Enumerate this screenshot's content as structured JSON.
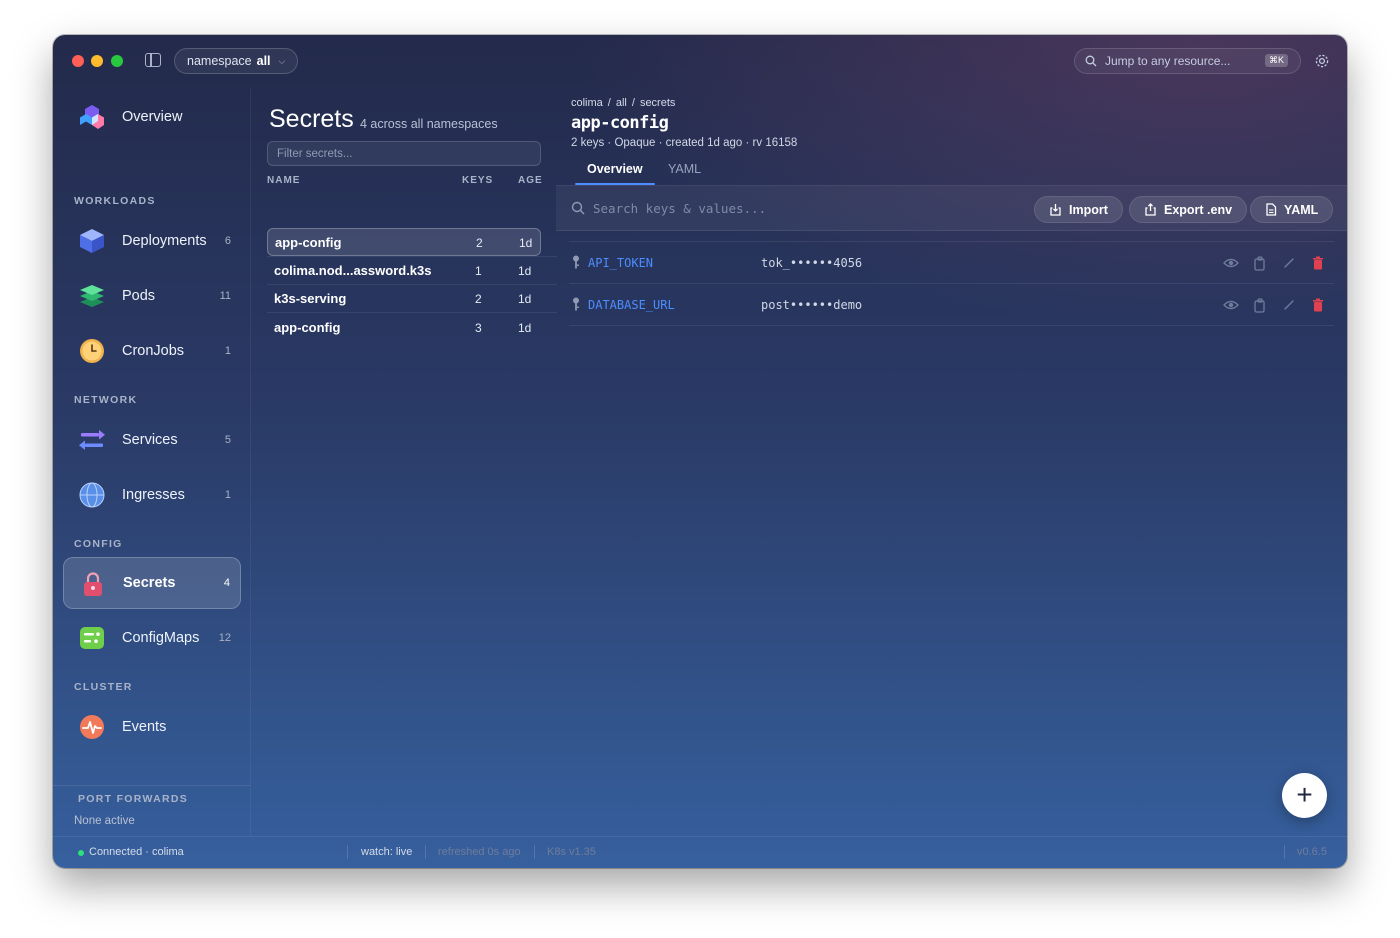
{
  "titlebar": {
    "namespace_prefix": "namespace",
    "namespace_value": "all",
    "jump_placeholder": "Jump to any resource...",
    "jump_shortcut": "⌘K"
  },
  "sidebar": {
    "overview": "Overview",
    "sections": {
      "workloads": "WORKLOADS",
      "network": "NETWORK",
      "config": "CONFIG",
      "cluster": "CLUSTER"
    },
    "items": {
      "deployments": {
        "label": "Deployments",
        "count": "6"
      },
      "pods": {
        "label": "Pods",
        "count": "11"
      },
      "cronjobs": {
        "label": "CronJobs",
        "count": "1"
      },
      "services": {
        "label": "Services",
        "count": "5"
      },
      "ingresses": {
        "label": "Ingresses",
        "count": "1"
      },
      "secrets": {
        "label": "Secrets",
        "count": "4"
      },
      "configmaps": {
        "label": "ConfigMaps",
        "count": "12"
      },
      "events": {
        "label": "Events"
      }
    },
    "port_forwards_title": "PORT FORWARDS",
    "port_forwards_value": "None active"
  },
  "list": {
    "title": "Secrets",
    "subtitle": "4 across all namespaces",
    "filter_placeholder": "Filter secrets...",
    "headers": {
      "name": "NAME",
      "keys": "KEYS",
      "age": "AGE"
    },
    "rows": [
      {
        "name": "app-config",
        "keys": "2",
        "age": "1d"
      },
      {
        "name": "colima.nod...assword.k3s",
        "keys": "1",
        "age": "1d"
      },
      {
        "name": "k3s-serving",
        "keys": "2",
        "age": "1d"
      },
      {
        "name": "app-config",
        "keys": "3",
        "age": "1d"
      }
    ]
  },
  "detail": {
    "breadcrumb": [
      "colima",
      "all",
      "secrets"
    ],
    "title": "app-config",
    "meta": "2 keys · Opaque · created 1d ago · rv 16158",
    "tabs": {
      "overview": "Overview",
      "yaml": "YAML"
    },
    "search_placeholder": "Search keys & values...",
    "buttons": {
      "import": "Import",
      "export": "Export .env",
      "yaml": "YAML"
    },
    "entries": [
      {
        "key": "API_TOKEN",
        "value": "tok_••••••4056"
      },
      {
        "key": "DATABASE_URL",
        "value": "post••••••demo"
      }
    ]
  },
  "fab_label": "+",
  "status": {
    "connection": "Connected · colima",
    "watch": "watch: live",
    "refreshed": "refreshed 0s ago",
    "k8s": "K8s v1.35",
    "version": "v0.6.5"
  },
  "colors": {
    "accent": "#4c8dff",
    "danger": "#e0404f",
    "connected": "#2ee07a"
  }
}
